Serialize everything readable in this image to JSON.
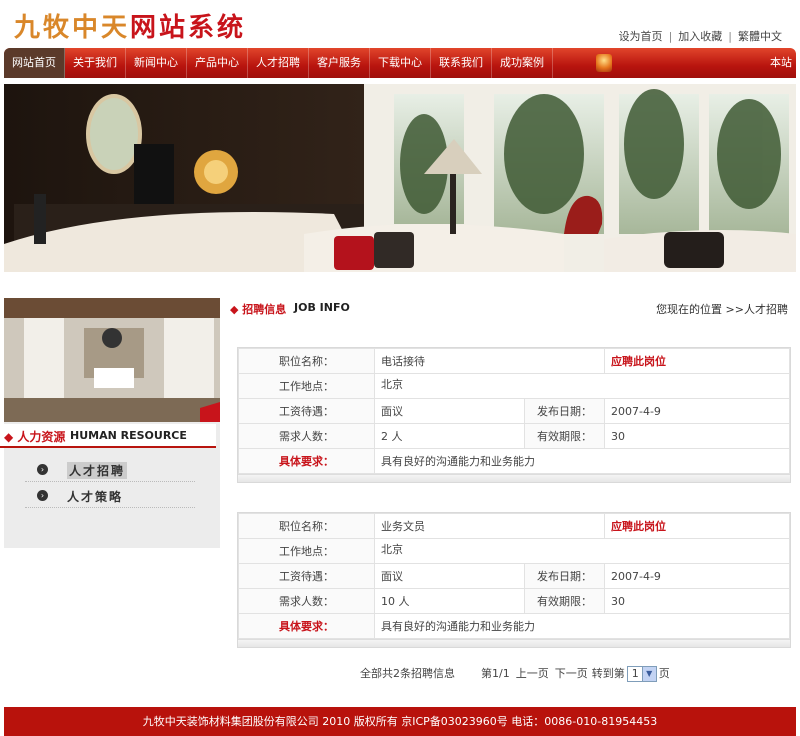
{
  "header": {
    "logo_part1": "九牧中天",
    "logo_part2": "网站系统",
    "links": [
      "设为首页",
      "加入收藏",
      "繁體中文"
    ]
  },
  "nav": {
    "items": [
      "网站首页",
      "关于我们",
      "新闻中心",
      "产品中心",
      "人才招聘",
      "客户服务",
      "下载中心",
      "联系我们",
      "成功案例"
    ],
    "marquee": "本站"
  },
  "sidebar": {
    "title_zh": "人力资源",
    "title_en": "HUMAN RESOURCE",
    "items": [
      "人才招聘",
      "人才策略"
    ]
  },
  "main": {
    "title_zh": "招聘信息",
    "title_en": "JOB INFO",
    "breadcrumb": "您现在的位置 >>人才招聘"
  },
  "labels": {
    "position": "职位名称：",
    "location": "工作地点：",
    "salary": "工资待遇：",
    "publish": "发布日期：",
    "count": "需求人数：",
    "validity": "有效期限：",
    "requirement": "具体要求：",
    "apply": "应聘此岗位"
  },
  "jobs": [
    {
      "position": "电话接待",
      "location": "北京",
      "salary": "面议",
      "date": "2007-4-9",
      "count": "2 人",
      "validity": "30",
      "requirement": "具有良好的沟通能力和业务能力"
    },
    {
      "position": "业务文员",
      "location": "北京",
      "salary": "面议",
      "date": "2007-4-9",
      "count": "10 人",
      "validity": "30",
      "requirement": "具有良好的沟通能力和业务能力"
    }
  ],
  "pager": {
    "total": "全部共2条招聘信息",
    "page": "第1/1",
    "prev": "上一页",
    "next": "下一页",
    "goto": "转到第",
    "current": "1",
    "suffix": "页"
  },
  "footer": {
    "text": "九牧中天装饰材料集团股份有限公司 2010 版权所有 京ICP备03023960号 电话：0086-010-81954453"
  },
  "colors": {
    "brand_red": "#b8140e",
    "title_red": "#c8141b",
    "logo_orange": "#d9872a"
  }
}
